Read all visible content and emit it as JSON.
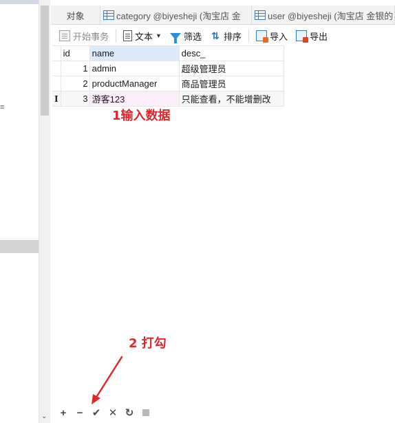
{
  "tabs": [
    {
      "label": "对象"
    },
    {
      "label": "category @biyesheji (淘宝店  金"
    },
    {
      "label": "user @biyesheji (淘宝店  金银的"
    }
  ],
  "toolbar": {
    "begin_transaction": "开始事务",
    "text": "文本",
    "filter": "筛选",
    "sort": "排序",
    "import": "导入",
    "export": "导出"
  },
  "grid": {
    "columns": [
      "id",
      "name",
      "desc_"
    ],
    "rows": [
      {
        "id": "1",
        "name": "admin",
        "desc": "超级管理员"
      },
      {
        "id": "2",
        "name": "productManager",
        "desc": "商品管理员"
      },
      {
        "id": "3",
        "name": "游客123",
        "desc": "只能查看，不能增删改"
      }
    ],
    "new_row_marker": "I"
  },
  "annotations": {
    "step1": "1输入数据",
    "step2": "2  打勾"
  },
  "bottom_bar": {
    "add": "+",
    "delete": "−",
    "apply": "✔",
    "discard": "✕",
    "refresh": "↻"
  },
  "left_panel": {
    "edge_glyph": "≡"
  },
  "colors": {
    "annotation_red": "#e0262b",
    "selected_header": "#dceafb",
    "accent_blue": "#3b7bc0"
  }
}
